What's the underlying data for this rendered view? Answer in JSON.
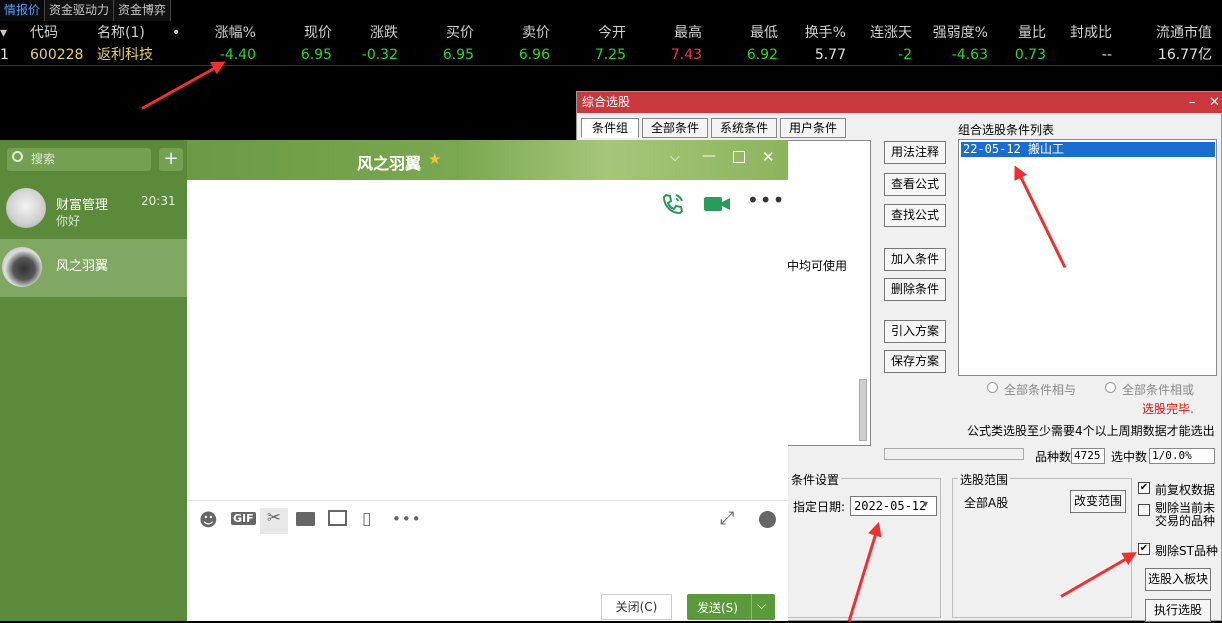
{
  "quote": {
    "tabs": [
      "情报价",
      "资金驱动力",
      "资金博弈"
    ],
    "headers": [
      "代码",
      "名称(1)",
      "•",
      "涨幅%",
      "现价",
      "涨跌",
      "买价",
      "卖价",
      "今开",
      "最高",
      "最低",
      "换手%",
      "连涨天",
      "强弱度%",
      "量比",
      "封成比",
      "流通市值"
    ],
    "row": {
      "index": "1",
      "code": "600228",
      "name": "返利科技",
      "change_pct": "-4.40",
      "price": "6.95",
      "change": "-0.32",
      "bid": "6.95",
      "ask": "6.96",
      "open": "7.25",
      "high": "7.43",
      "low": "6.92",
      "turnover": "5.77",
      "up_days": "-2",
      "strength": "-4.63",
      "vol_ratio": "0.73",
      "seal_ratio": "--",
      "float_mv": "16.77亿"
    }
  },
  "selector": {
    "title": "综合选股",
    "tabs": [
      "条件组",
      "全部条件",
      "系统条件",
      "用户条件"
    ],
    "partial_text": "中均可使用",
    "buttons": [
      "用法注释",
      "查看公式",
      "查找公式",
      "加入条件",
      "删除条件",
      "引入方案",
      "保存方案"
    ],
    "list_title": "组合选股条件列表",
    "list_items": [
      "22-05-12 搬山工"
    ],
    "radio_all_and": "全部条件相与",
    "radio_all_or": "全部条件相或",
    "status": "选股完毕.",
    "note": "公式类选股至少需要4个以上周期数据才能选出",
    "count_label": "品种数",
    "count_value": "4725",
    "selected_label": "选中数",
    "selected_value": "1/0.0%",
    "cond_group": "条件设置",
    "date_label": "指定日期:",
    "date_value": "2022-05-12",
    "range_group": "选股范围",
    "range_value": "全部A股",
    "change_range": "改变范围",
    "opt_fq": "前复权数据",
    "opt_remove_new": "剔除当前未交易的品种",
    "opt_remove_st": "剔除ST品种",
    "to_block": "选股入板块",
    "run": "执行选股"
  },
  "chat": {
    "search_placeholder": "搜索",
    "title": "风之羽翼",
    "contacts": [
      {
        "name": "财富管理",
        "msg": "你好",
        "time": "20:31"
      },
      {
        "name": "风之羽翼",
        "msg": "",
        "time": ""
      }
    ],
    "close_label": "关闭(C)",
    "send_label": "发送(S)"
  }
}
